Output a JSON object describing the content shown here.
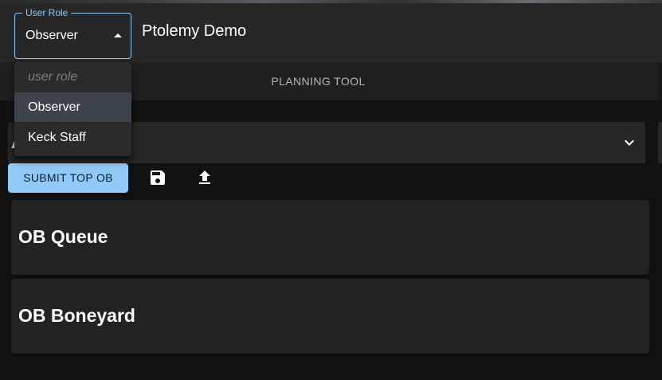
{
  "app": {
    "title": "Ptolemy Demo"
  },
  "role_select": {
    "legend": "User Role",
    "value": "Observer",
    "options": [
      {
        "label": "user role",
        "placeholder": true
      },
      {
        "label": "Observer",
        "selected": true
      },
      {
        "label": "Keck Staff"
      }
    ]
  },
  "tabs": [
    {
      "label": "PLANNING TOOL"
    }
  ],
  "accordion": {
    "title": "Ab"
  },
  "toolbar": {
    "submit_label": "SUBMIT TOP OB",
    "save_icon": "save-icon",
    "upload_icon": "upload-icon"
  },
  "cards": [
    {
      "title": "OB Queue"
    },
    {
      "title": "OB Boneyard"
    }
  ],
  "colors": {
    "accent": "#90caf9",
    "appbar": "#272727",
    "background": "#121212",
    "card": "#232323"
  }
}
